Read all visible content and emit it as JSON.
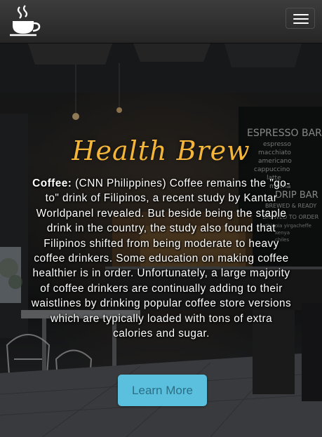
{
  "navbar": {
    "logo_icon": "coffee-cup-icon",
    "menu_icon": "hamburger-menu-icon"
  },
  "hero": {
    "title": "Health Brew",
    "lead_label": "Coffee:",
    "body": "(CNN Philippines) Coffee remains the \"go-to\" drink of Filipinos, a recent study by Kantar Worldpanel revealed. But beside being the staple drink in the country, the study also found that Filipinos shifted from being moderate to heavy coffee drinkers. Some education on making coffee healthier is in order. Unfortunately, a large majority of coffee drinkers are continually adding to their waistlines by drinking popular coffee store versions which are typically loaded with tons of extra calories and sugar.",
    "button_label": "Learn More"
  },
  "background_board": {
    "espresso_bar": "ESPRESSO BAR",
    "items": [
      "espresso",
      "macchiato",
      "americano",
      "cappuccino",
      "latte",
      "mocha"
    ],
    "drip_bar": "DRIP BAR",
    "drip_sub": "BREWED & READY",
    "drip_sub2": "BREWED TO ORDER",
    "drip_items": [
      "ethiopia yirgacheffe",
      "kenya",
      "chiles"
    ]
  },
  "colors": {
    "accent": "#f4b63a",
    "button_bg": "#5bc0de",
    "button_text": "#2a6f86",
    "navbar_bg": "#2f2f2f"
  }
}
